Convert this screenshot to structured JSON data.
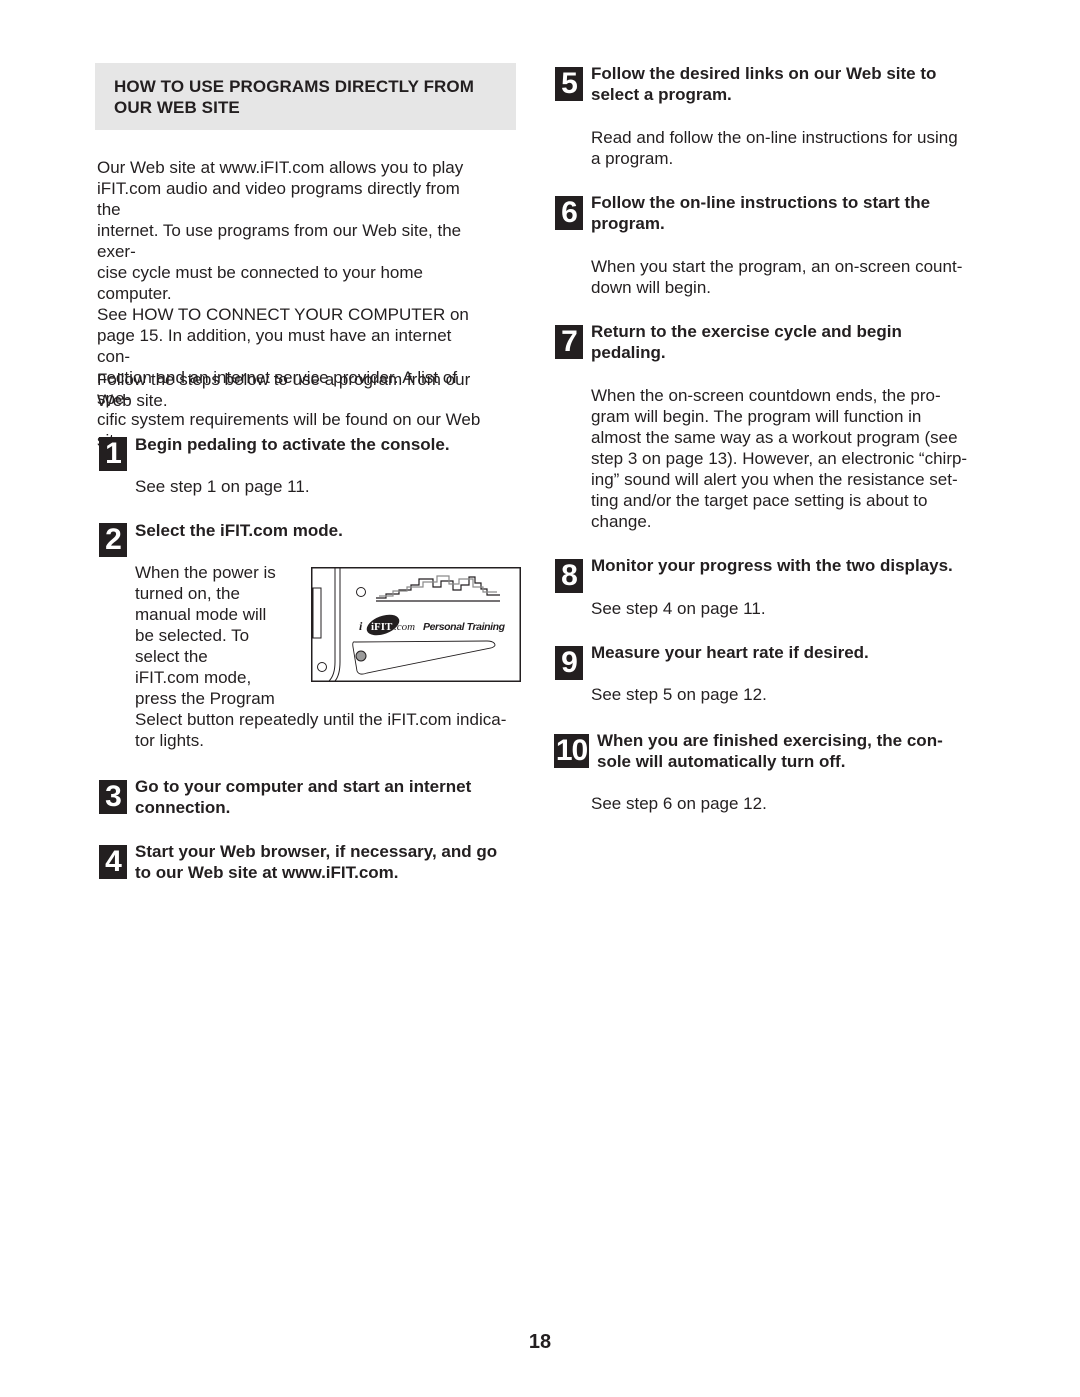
{
  "section": {
    "title": "HOW TO USE PROGRAMS DIRECTLY FROM OUR WEB SITE",
    "intro_lines": [
      "Our Web site at www.iFIT.com allows you to play",
      "iFIT.com audio and video programs directly from the",
      "internet. To use programs from our Web site, the exer-",
      "cise cycle must be connected to your home computer.",
      "See HOW TO CONNECT YOUR COMPUTER on",
      "page 15. In addition, you must have an internet con-",
      "nection and an internet service provider. A list of spe-",
      "cific system requirements will be found on our Web",
      "site."
    ],
    "follow_lines": [
      "Follow the steps below to use a program from our",
      "Web site."
    ]
  },
  "steps": [
    {
      "number": "1",
      "heading_lines": [
        "Begin pedaling to activate the console."
      ],
      "body_lines": [
        "See step 1 on page 11."
      ]
    },
    {
      "number": "2",
      "heading_lines": [
        "Select the iFIT.com mode."
      ],
      "body_lines": [
        "When the power is",
        "turned on, the",
        "manual mode will",
        "be selected. To",
        "select the",
        "iFIT.com mode,",
        "press the Program",
        "Select button repeatedly until the iFIT.com indica-",
        "tor lights."
      ]
    },
    {
      "number": "3",
      "heading_lines": [
        "Go to your computer and start an internet",
        "connection."
      ],
      "body_lines": []
    },
    {
      "number": "4",
      "heading_lines": [
        "Start your Web browser, if necessary, and go",
        "to our Web site at www.iFIT.com."
      ],
      "body_lines": []
    },
    {
      "number": "5",
      "heading_lines": [
        "Follow the desired links on our Web site to",
        "select a program."
      ],
      "body_lines": [
        "Read and follow the on-line instructions for using",
        "a program."
      ]
    },
    {
      "number": "6",
      "heading_lines": [
        "Follow the on-line instructions to start the",
        "program."
      ],
      "body_lines": [
        "When you start the program, an on-screen count-",
        "down will begin."
      ]
    },
    {
      "number": "7",
      "heading_lines": [
        "Return to the exercise cycle and begin",
        "pedaling."
      ],
      "body_lines": [
        "When the on-screen countdown ends, the pro-",
        "gram will begin. The program will function in",
        "almost the same way as a workout program (see",
        "step 3 on page 13). However, an electronic “chirp-",
        "ing” sound will alert you when the resistance set-",
        "ting and/or the target pace setting is about to",
        "change."
      ]
    },
    {
      "number": "8",
      "heading_lines": [
        "Monitor your progress with the two displays."
      ],
      "body_lines": [
        "See step 4 on page 11."
      ]
    },
    {
      "number": "9",
      "heading_lines": [
        "Measure your heart rate if desired."
      ],
      "body_lines": [
        "See step 5 on page 12."
      ]
    },
    {
      "number": "10",
      "heading_lines": [
        "When you are finished exercising, the con-",
        "sole will automatically turn off."
      ],
      "body_lines": [
        "See step 6 on page 12."
      ]
    }
  ],
  "console_illustration": {
    "logo_text": "iFIT",
    "logo_suffix": ".com",
    "label": "Personal Training"
  },
  "page_number": "18"
}
